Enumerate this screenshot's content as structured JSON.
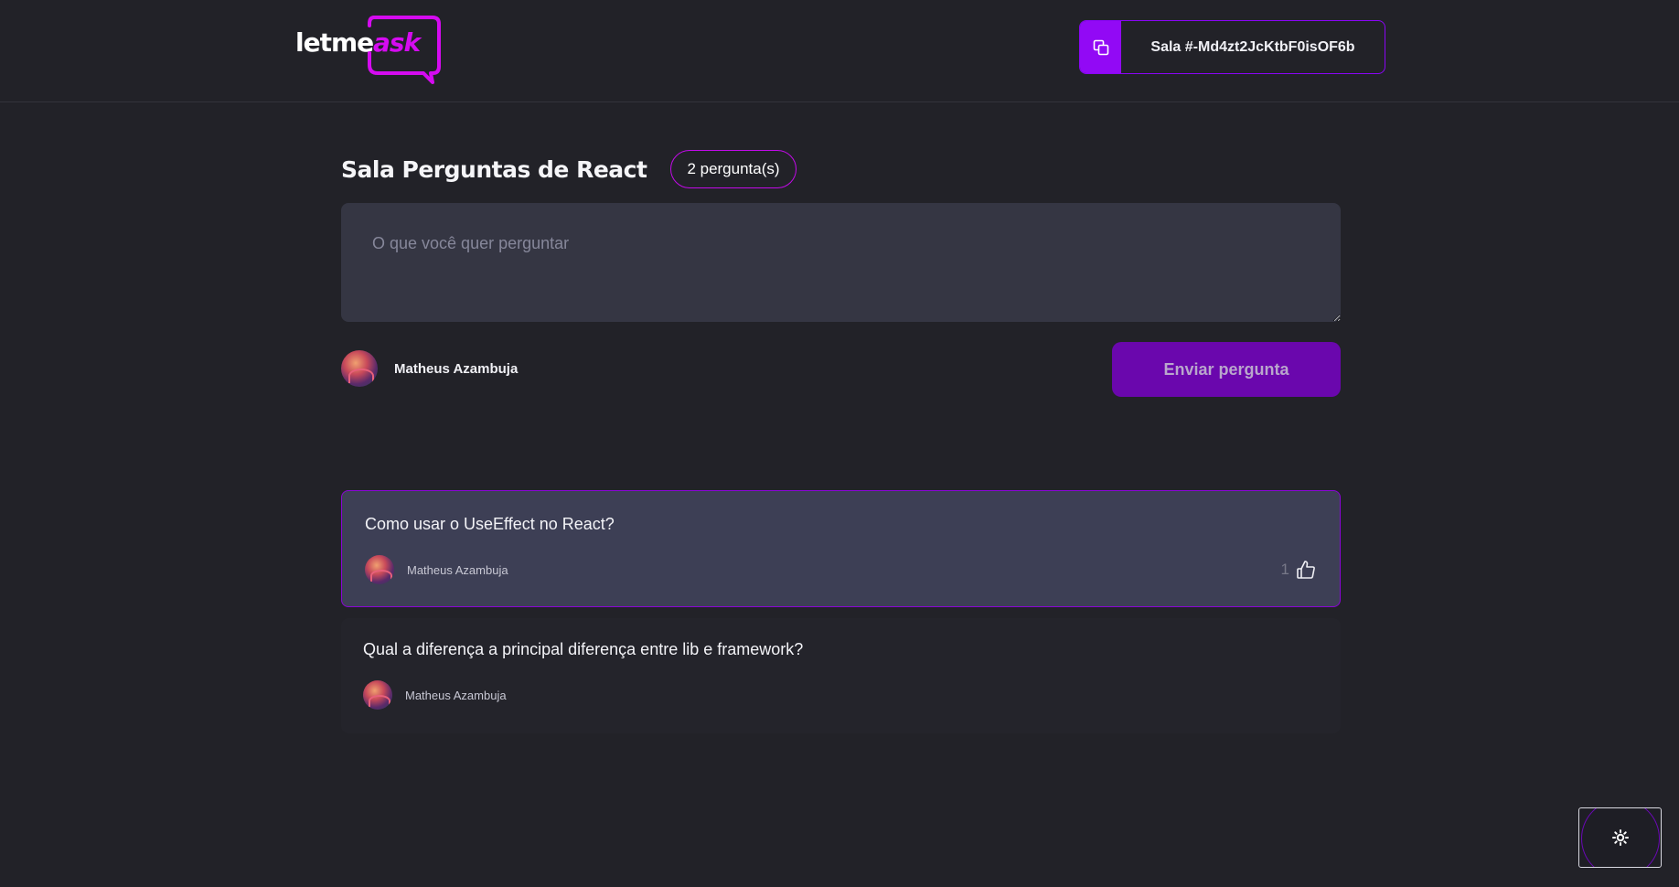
{
  "header": {
    "logo": {
      "part1": "letme",
      "part2": "ask"
    },
    "room_code": {
      "label": "Sala #-Md4zt2JcKtbF0isOF6b",
      "icon": "copy-icon"
    }
  },
  "room": {
    "title": "Sala Perguntas de React",
    "question_count": "2 pergunta(s)"
  },
  "form": {
    "placeholder": "O que você quer perguntar",
    "value": "",
    "user_name": "Matheus Azambuja",
    "submit_label": "Enviar pergunta"
  },
  "questions": [
    {
      "content": "Como usar o UseEffect no React?",
      "author": "Matheus Azambuja",
      "like_count": "1",
      "highlighted": true
    },
    {
      "content": "Qual a diferença a principal diferença entre lib e framework?",
      "author": "Matheus Azambuja",
      "highlighted": false
    }
  ],
  "theme_toggle": {
    "icon": "sun-icon"
  },
  "colors": {
    "background": "#222228",
    "accent": "#9209f5",
    "highlight_border": "#8a05d5",
    "button": "#6a07ad",
    "logo_accent": "#d50bf0"
  }
}
